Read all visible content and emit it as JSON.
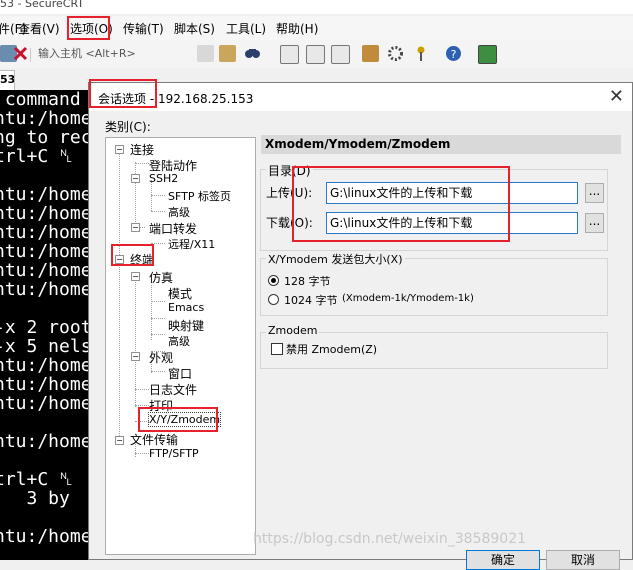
{
  "app": {
    "title": "53 - SecureCRT"
  },
  "menu": [
    "件(F)",
    "查看(V)",
    "选项(O)",
    "传输(T)",
    "脚本(S)",
    "工具(L)",
    "帮助(H)"
  ],
  "toolbar": {
    "host_placeholder": "输入主机 <Alt+R>"
  },
  "session_tab": {
    "label": "53"
  },
  "terminal": {
    "lines": [
      {
        "text": " command"
      },
      {
        "text": "ntu:/home"
      },
      {
        "text": "ng to rec"
      },
      {
        "text": "trl+C ␤"
      },
      {
        "text": "ntu:/home"
      },
      {
        "text": "ntu:/home"
      },
      {
        "text": "ntu:/home"
      },
      {
        "text": "ntu:/home"
      },
      {
        "text": "ntu:/home"
      },
      {
        "text": "ntu:/home"
      },
      {
        "text": "-x 2 root"
      },
      {
        "text": "-x 5 nels"
      },
      {
        "text": "ntu:/home"
      },
      {
        "text": "ntu:/home"
      },
      {
        "text": "ntu:/home"
      },
      {
        "text": "ntu:/home"
      },
      {
        "text": "trl+C ␤"
      },
      {
        "text": "   3 by"
      },
      {
        "text": "ntu:/home"
      }
    ]
  },
  "dialog": {
    "title": "会话选项 - 192.168.25.153",
    "category_label": "类别(C):",
    "tree": {
      "connection": "连接",
      "login_actions": "登陆动作",
      "ssh2": "SSH2",
      "sftp_tab": "SFTP 标签页",
      "advanced": "高级",
      "port_forwarding": "端口转发",
      "remote_x11": "远程/X11",
      "terminal": "终端",
      "emulation": "仿真",
      "modes": "模式",
      "emacs": "Emacs",
      "mapped_keys": "映射键",
      "emulation_advanced": "高级",
      "appearance": "外观",
      "window": "窗口",
      "log_file": "日志文件",
      "printing": "打印",
      "xyzmodem": "X/Y/Zmodem",
      "file_transfer": "文件传输",
      "ftp_sftp": "FTP/SFTP"
    },
    "panel": {
      "header": "Xmodem/Ymodem/Zmodem",
      "directories_label": "目录(D)",
      "upload_label": "上传(U):",
      "upload_value": "G:\\linux文件的上传和下载",
      "download_label": "下载(O):",
      "download_value": "G:\\linux文件的上传和下载",
      "browse_label": "...",
      "packet_size_label": "X/Ymodem 发送包大小(X)",
      "opt_128": "128 字节",
      "opt_1024": "1024 字节",
      "opt_1024_note": "(Xmodem-1k/Ymodem-1k)",
      "zmodem_label": "Zmodem",
      "disable_zmodem": "禁用 Zmodem(Z)"
    },
    "ok_label": "确定",
    "cancel_label": "取消"
  },
  "watermark": "https://blog.csdn.net/weixin_38589021",
  "colors": {
    "highlight_box": "#e5212b",
    "input_focus": "#2b78c2",
    "selected_tree_bg": "#ffffff"
  }
}
